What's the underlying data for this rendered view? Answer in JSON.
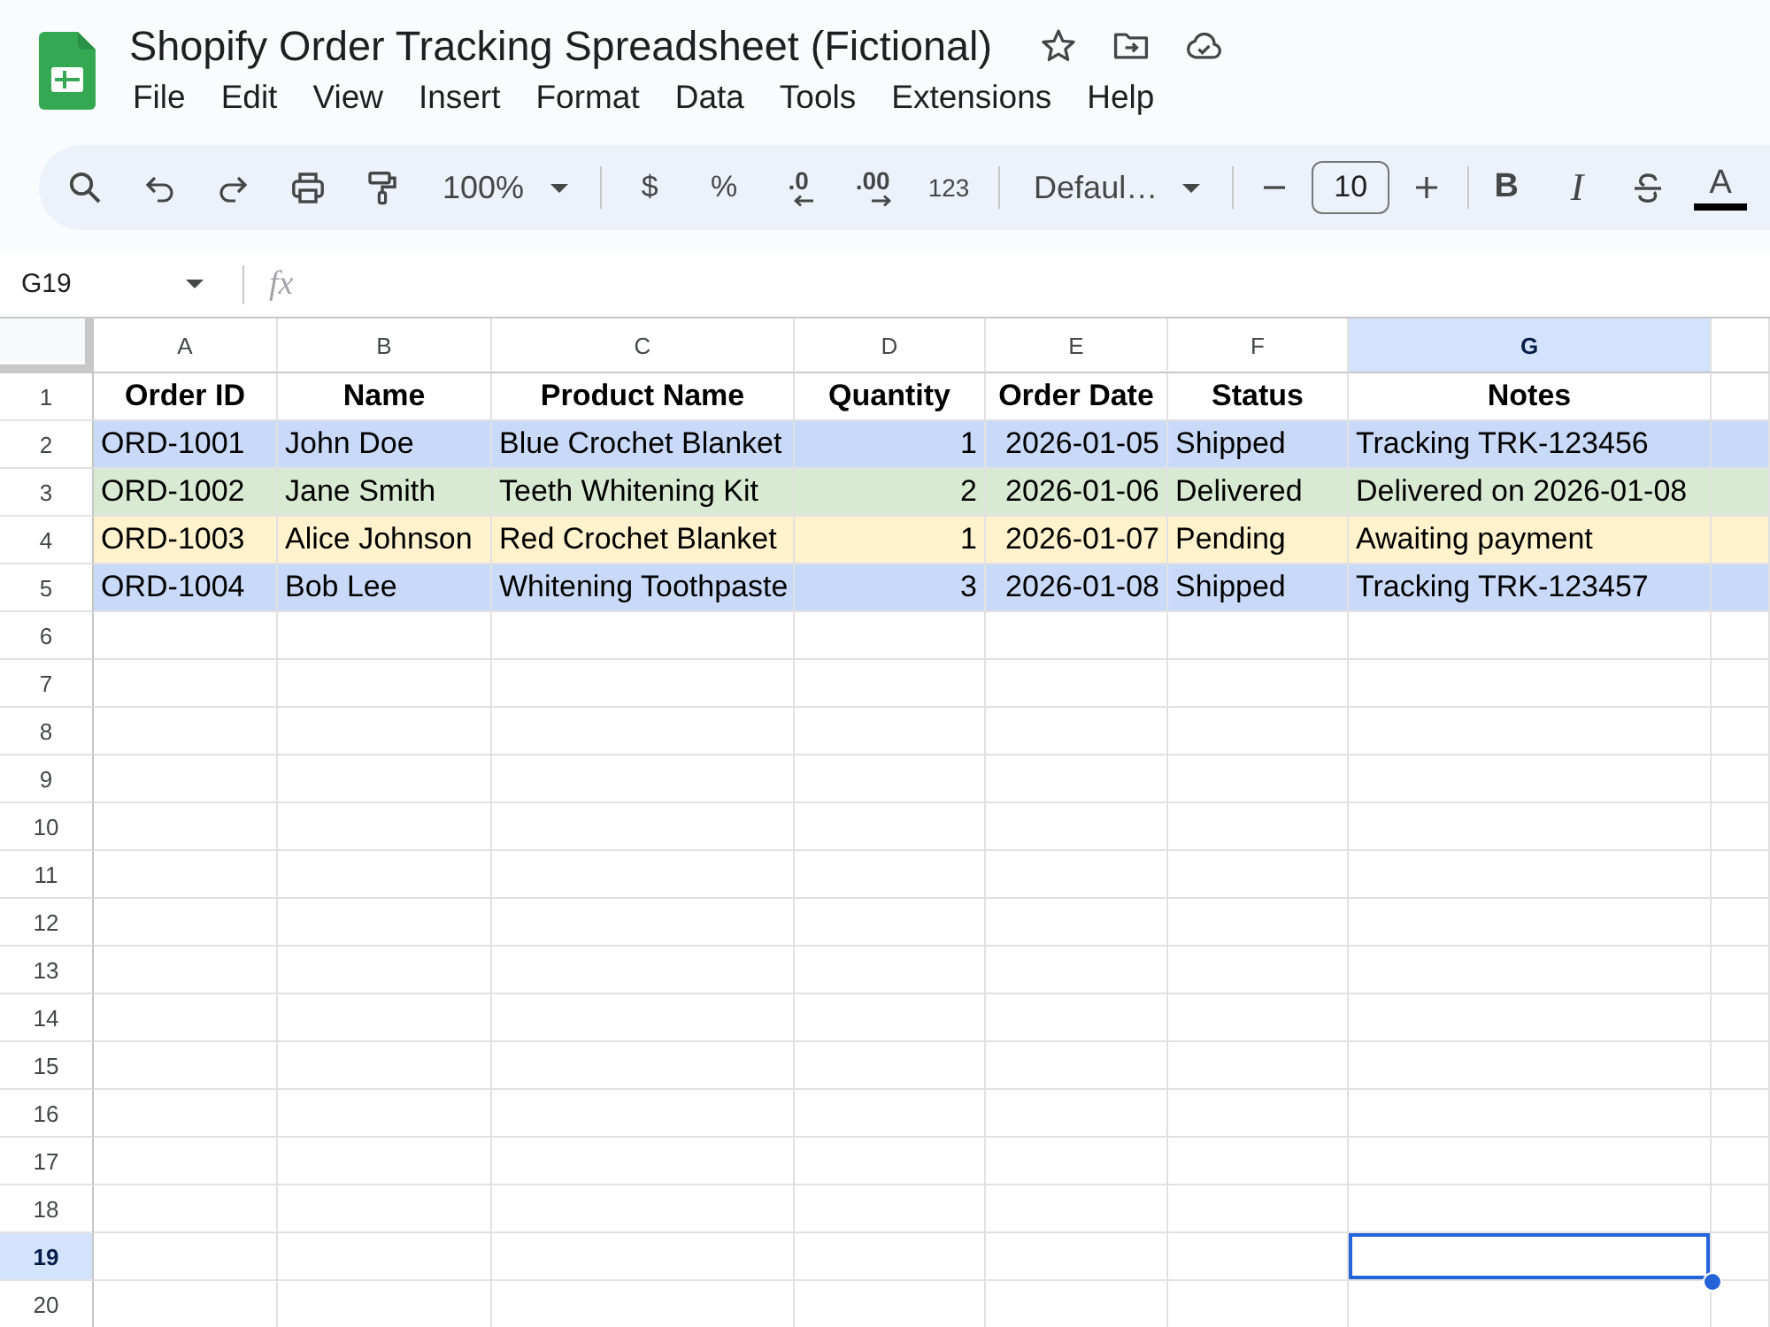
{
  "document": {
    "title": "Shopify Order Tracking Spreadsheet (Fictional)"
  },
  "menu": [
    "File",
    "Edit",
    "View",
    "Insert",
    "Format",
    "Data",
    "Tools",
    "Extensions",
    "Help"
  ],
  "toolbar": {
    "zoom": "100%",
    "currency": "$",
    "percent": "%",
    "decrease_decimal": ".0",
    "increase_decimal": ".00",
    "number_format": "123",
    "font": "Defaul…",
    "font_size": "10",
    "bold": "B",
    "italic": "I",
    "text_color": "A"
  },
  "formula_bar": {
    "cell_ref": "G19",
    "function_label": "fx"
  },
  "sheet": {
    "columns": [
      {
        "letter": "A",
        "kind": "text",
        "selected": false
      },
      {
        "letter": "B",
        "kind": "text",
        "selected": false
      },
      {
        "letter": "C",
        "kind": "text",
        "selected": false
      },
      {
        "letter": "D",
        "kind": "number",
        "selected": false
      },
      {
        "letter": "E",
        "kind": "date",
        "selected": false
      },
      {
        "letter": "F",
        "kind": "text",
        "selected": false
      },
      {
        "letter": "G",
        "kind": "text",
        "selected": true
      }
    ],
    "rows": [
      {
        "number": "1",
        "kind": "header",
        "selected": false,
        "cells": [
          "Order ID",
          "Name",
          "Product Name",
          "Quantity",
          "Order Date",
          "Status",
          "Notes"
        ]
      },
      {
        "number": "2",
        "kind": "data",
        "selected": false,
        "color": "#c9daf8",
        "cells": [
          "ORD-1001",
          "John Doe",
          "Blue Crochet Blanket",
          "1",
          "2026-01-05",
          "Shipped",
          "Tracking TRK-123456"
        ]
      },
      {
        "number": "3",
        "kind": "data",
        "selected": false,
        "color": "#d9ead3",
        "cells": [
          "ORD-1002",
          "Jane Smith",
          "Teeth Whitening Kit",
          "2",
          "2026-01-06",
          "Delivered",
          "Delivered on 2026-01-08"
        ]
      },
      {
        "number": "4",
        "kind": "data",
        "selected": false,
        "color": "#fff2cc",
        "cells": [
          "ORD-1003",
          "Alice Johnson",
          "Red Crochet Blanket",
          "1",
          "2026-01-07",
          "Pending",
          "Awaiting payment"
        ]
      },
      {
        "number": "5",
        "kind": "data",
        "selected": false,
        "color": "#c9daf8",
        "cells": [
          "ORD-1004",
          "Bob Lee",
          "Whitening Toothpaste",
          "3",
          "2026-01-08",
          "Shipped",
          "Tracking TRK-123457"
        ]
      },
      {
        "number": "6",
        "kind": "empty",
        "selected": false
      },
      {
        "number": "7",
        "kind": "empty",
        "selected": false
      },
      {
        "number": "8",
        "kind": "empty",
        "selected": false
      },
      {
        "number": "9",
        "kind": "empty",
        "selected": false
      },
      {
        "number": "10",
        "kind": "empty",
        "selected": false
      },
      {
        "number": "11",
        "kind": "empty",
        "selected": false
      },
      {
        "number": "12",
        "kind": "empty",
        "selected": false
      },
      {
        "number": "13",
        "kind": "empty",
        "selected": false
      },
      {
        "number": "14",
        "kind": "empty",
        "selected": false
      },
      {
        "number": "15",
        "kind": "empty",
        "selected": false
      },
      {
        "number": "16",
        "kind": "empty",
        "selected": false
      },
      {
        "number": "17",
        "kind": "empty",
        "selected": false
      },
      {
        "number": "18",
        "kind": "empty",
        "selected": false
      },
      {
        "number": "19",
        "kind": "empty",
        "selected": true
      },
      {
        "number": "20",
        "kind": "empty",
        "selected": false
      }
    ]
  }
}
